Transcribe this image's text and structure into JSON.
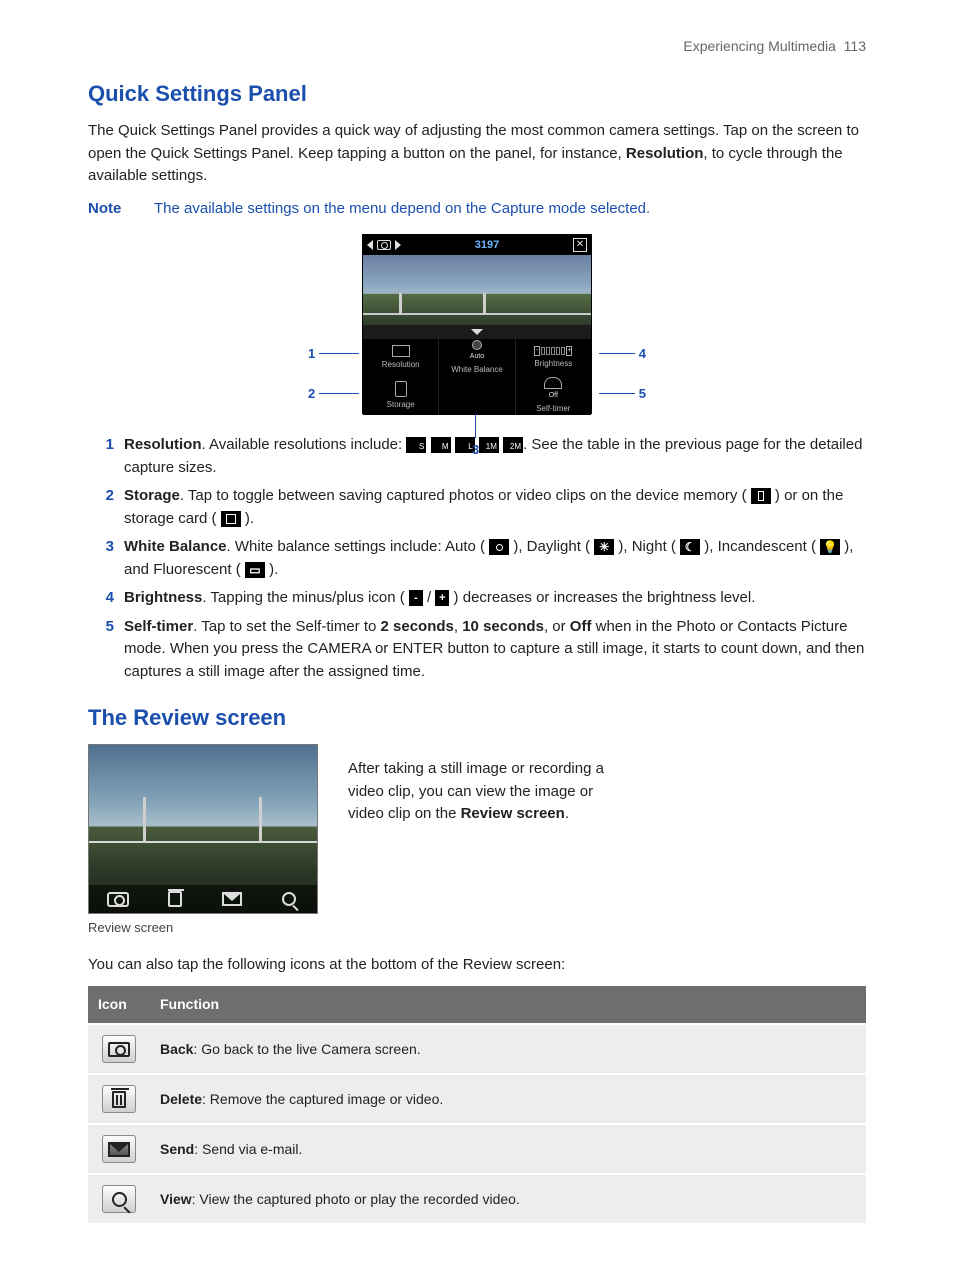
{
  "header": {
    "section": "Experiencing Multimedia",
    "page": "113"
  },
  "h2a": "Quick Settings Panel",
  "intro1_a": "The Quick Settings Panel provides a quick way of adjusting the most common camera settings. Tap on the screen to open the Quick Settings Panel. Keep tapping a button on the panel, for instance, ",
  "intro1_b": "Resolution",
  "intro1_c": ", to cycle through the available settings.",
  "note_label": "Note",
  "note_text": "The available settings on the menu depend on the Capture mode selected.",
  "screenshot": {
    "count": "3197",
    "cells": {
      "resolution": "Resolution",
      "wb_mode": "Auto",
      "wb_label": "White Balance",
      "brightness": "Brightness",
      "storage": "Storage",
      "selftimer_mode": "Off",
      "selftimer": "Self-timer"
    },
    "callouts": {
      "c1": "1",
      "c2": "2",
      "c3": "3",
      "c4": "4",
      "c5": "5"
    }
  },
  "list": {
    "n1": "1",
    "t1a": "Resolution",
    "t1b": ". Available resolutions include: ",
    "res": {
      "s": "S",
      "m": "M",
      "l": "L",
      "m1": "1M",
      "m2": "2M"
    },
    "t1c": ". See the table in the previous page for the detailed capture sizes.",
    "n2": "2",
    "t2a": "Storage",
    "t2b": ". Tap to toggle between saving captured photos or video clips on the device memory ( ",
    "t2c": " ) or on the storage card ( ",
    "t2d": " ).",
    "n3": "3",
    "t3a": "White Balance",
    "t3b": ". White balance settings include: Auto ( ",
    "t3c": " ), Daylight ( ",
    "t3d": " ), Night ( ",
    "t3e": " ), Incandescent ( ",
    "t3f": " ), and Fluorescent ( ",
    "t3g": " ).",
    "n4": "4",
    "t4a": "Brightness",
    "t4b": ". Tapping the minus/plus icon ( ",
    "t4mid": " / ",
    "t4c": " ) decreases or increases the brightness level.",
    "n5": "5",
    "t5a": "Self-timer",
    "t5b": ". Tap to set the Self-timer to ",
    "t5c": "2 seconds",
    "t5d": ", ",
    "t5e": "10 seconds",
    "t5f": ", or ",
    "t5g": "Off",
    "t5h": " when in the Photo or Contacts Picture mode. When you press the CAMERA or ENTER button to capture a still image, it starts to count down, and then captures a still image after the assigned time."
  },
  "h2b": "The Review screen",
  "review_para_a": "After taking a still image or recording a video clip, you can view the image or video clip on the ",
  "review_para_b": "Review screen",
  "review_para_c": ".",
  "review_caption": "Review screen",
  "review_lead": "You can also tap the following icons at the bottom of the Review screen:",
  "table": {
    "h1": "Icon",
    "h2": "Function",
    "r1a": "Back",
    "r1b": ": Go back to the live Camera screen.",
    "r2a": "Delete",
    "r2b": ": Remove the captured image or video.",
    "r3a": "Send",
    "r3b": ": Send via e-mail.",
    "r4a": "View",
    "r4b": ": View the captured photo or play the recorded video."
  }
}
